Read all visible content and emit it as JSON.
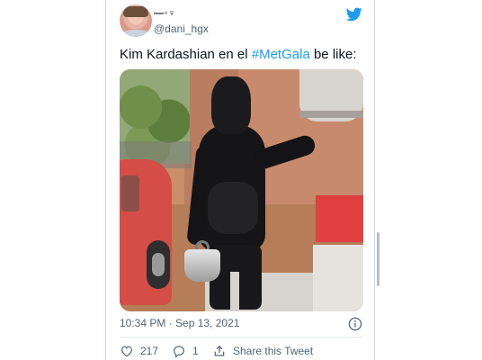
{
  "user": {
    "display_name": "—◦♀︎",
    "handle": "@dani_hgx",
    "avatar_icon": "profile-photo"
  },
  "tweet": {
    "text_before": "Kim Kardashian en el ",
    "hashtag": "#MetGala",
    "text_after": " be like:",
    "timestamp": "10:34 PM · Sep 13, 2021"
  },
  "actions": {
    "likes": "217",
    "replies": "1",
    "share_label": "Share this Tweet"
  },
  "icons": {
    "brand": "twitter-bird-icon",
    "info": "info-icon",
    "like": "heart-icon",
    "reply": "reply-bubble-icon",
    "share": "share-icon"
  },
  "colors": {
    "brand_blue": "#1d9bf0",
    "text_primary": "#0f1419",
    "text_secondary": "#536471",
    "border": "#cfd9de"
  }
}
